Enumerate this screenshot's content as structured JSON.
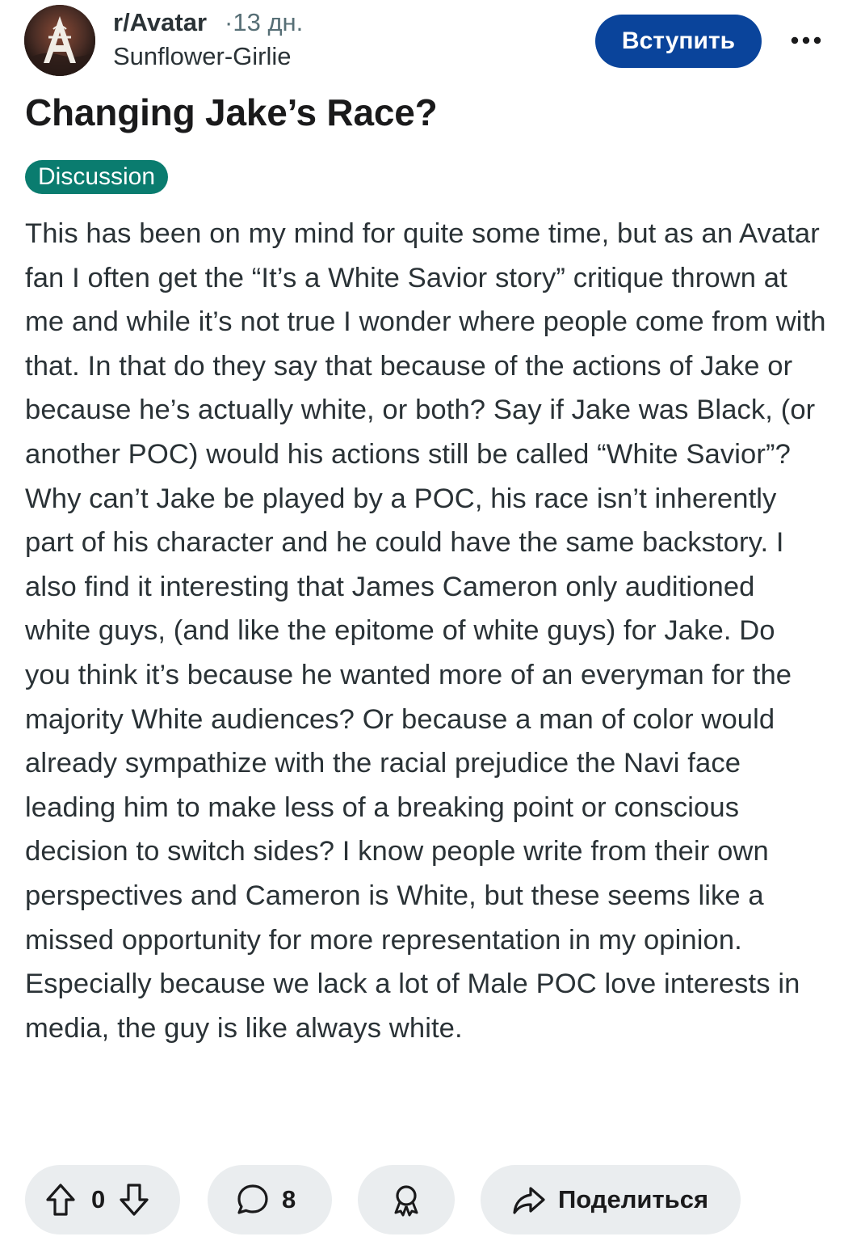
{
  "post": {
    "subreddit": "r/Avatar",
    "separator": "·",
    "age": "13 дн.",
    "author": "Sunflower-Girlie",
    "join_label": "Вступить",
    "more_icon": "more-horizontal-icon",
    "title": "Changing Jake’s Race?",
    "flair": "Discussion",
    "flair_color": "#0a7c6f",
    "join_color": "#0a449b",
    "body": "This has been on my mind for quite some time, but as an Avatar fan I often get the “It’s a White Savior story” critique thrown at me and while it’s not true I wonder where people come from with that. In that do they say that because of the actions of Jake or because he’s actually white, or both? Say if Jake was Black, (or another POC) would his actions still be called “White Savior”? Why can’t Jake be played by a POC, his race isn’t inherently part of his character and he could have the same backstory. I also find it interesting that James Cameron only auditioned white guys, (and like the epitome of white guys) for Jake. Do you think it’s because he wanted more of an everyman for the majority White audiences? Or because a man of color would already sympathize with the racial prejudice the Navi face leading him to make less of a breaking point or conscious decision to switch sides? I know people write from their own perspectives and Cameron is White, but these seems like a missed opportunity for more representation in my opinion. Especially because we lack a lot of Male POC love interests in media, the guy is like always white."
  },
  "actions": {
    "vote_count": "0",
    "comment_count": "8",
    "share_label": "Поделиться",
    "icons": [
      "upvote-icon",
      "downvote-icon",
      "comment-icon",
      "award-icon",
      "share-icon"
    ]
  }
}
